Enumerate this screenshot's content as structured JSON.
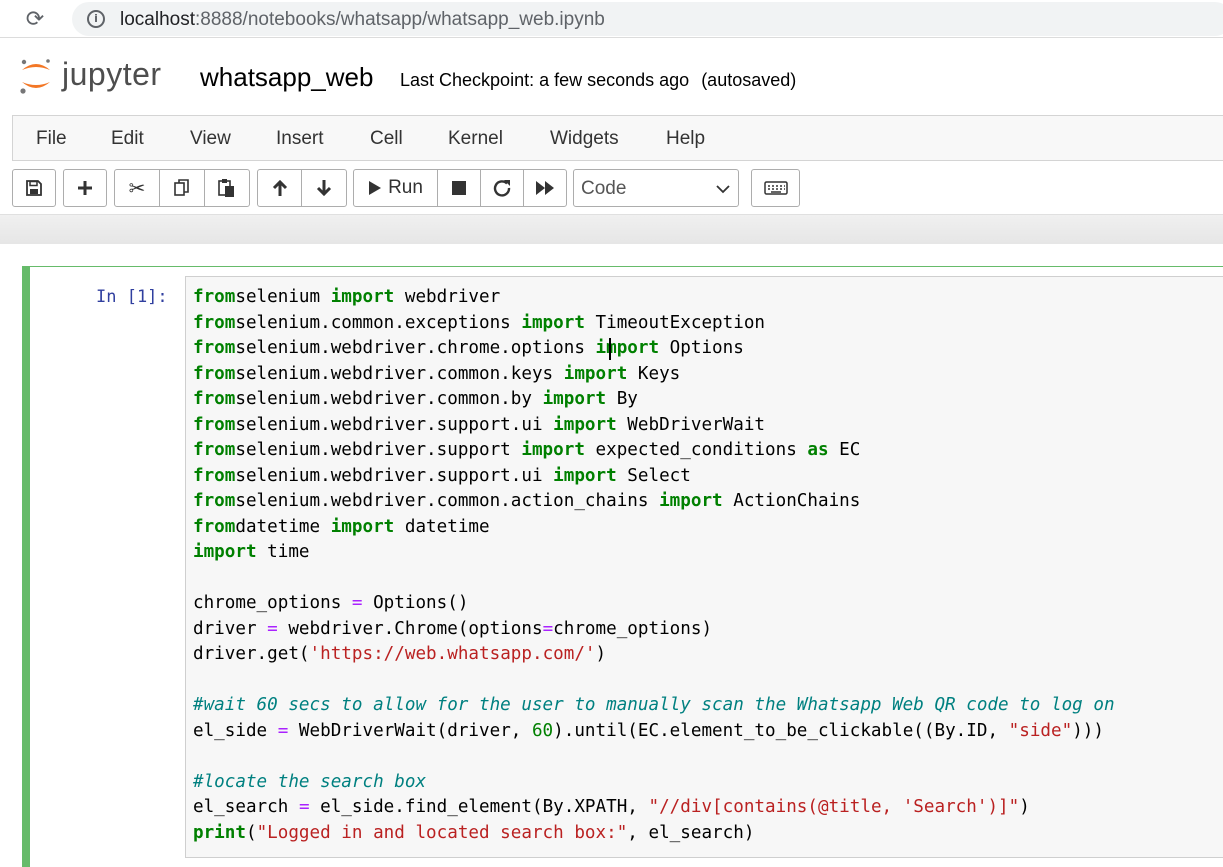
{
  "browser": {
    "url_host": "localhost",
    "url_rest": ":8888/notebooks/whatsapp/whatsapp_web.ipynb"
  },
  "header": {
    "logo_text": "jupyter",
    "notebook_name": "whatsapp_web",
    "checkpoint": "Last Checkpoint: a few seconds ago",
    "autosave": "(autosaved)"
  },
  "menu": [
    "File",
    "Edit",
    "View",
    "Insert",
    "Cell",
    "Kernel",
    "Widgets",
    "Help"
  ],
  "toolbar": {
    "run_label": "Run",
    "cell_type": "Code"
  },
  "cell": {
    "prompt": "In [1]:",
    "lines": [
      [
        [
          "kw",
          "from"
        ],
        [
          "",
          "selenium "
        ],
        [
          "kw",
          "import"
        ],
        [
          "",
          " webdriver"
        ]
      ],
      [
        [
          "kw",
          "from"
        ],
        [
          "",
          "selenium.common.exceptions "
        ],
        [
          "kw",
          "import"
        ],
        [
          "",
          " TimeoutException"
        ]
      ],
      [
        [
          "kw",
          "from"
        ],
        [
          "",
          "selenium.webdriver.chrome.options "
        ],
        [
          "kw",
          "import"
        ],
        [
          "",
          " Options"
        ]
      ],
      [
        [
          "kw",
          "from"
        ],
        [
          "",
          "selenium.webdriver.common.keys "
        ],
        [
          "kw",
          "import"
        ],
        [
          "",
          " Keys"
        ]
      ],
      [
        [
          "kw",
          "from"
        ],
        [
          "",
          "selenium.webdriver.common.by "
        ],
        [
          "kw",
          "import"
        ],
        [
          "",
          " By"
        ]
      ],
      [
        [
          "kw",
          "from"
        ],
        [
          "",
          "selenium.webdriver.support.ui "
        ],
        [
          "kw",
          "import"
        ],
        [
          "",
          " WebDriverWait"
        ]
      ],
      [
        [
          "kw",
          "from"
        ],
        [
          "",
          "selenium.webdriver.support "
        ],
        [
          "kw",
          "import"
        ],
        [
          "",
          " expected_conditions "
        ],
        [
          "kw",
          "as"
        ],
        [
          "",
          " EC"
        ]
      ],
      [
        [
          "kw",
          "from"
        ],
        [
          "",
          "selenium.webdriver.support.ui "
        ],
        [
          "kw",
          "import"
        ],
        [
          "",
          " Select"
        ]
      ],
      [
        [
          "kw",
          "from"
        ],
        [
          "",
          "selenium.webdriver.common.action_chains "
        ],
        [
          "kw",
          "import"
        ],
        [
          "",
          " ActionChains"
        ]
      ],
      [
        [
          "kw",
          "from"
        ],
        [
          "",
          "datetime "
        ],
        [
          "kw",
          "import"
        ],
        [
          "",
          " datetime"
        ]
      ],
      [
        [
          "kw",
          "import"
        ],
        [
          "",
          " time"
        ]
      ],
      [],
      [
        [
          "",
          "chrome_options "
        ],
        [
          "op",
          "="
        ],
        [
          "",
          " Options()"
        ]
      ],
      [
        [
          "",
          "driver "
        ],
        [
          "op",
          "="
        ],
        [
          "",
          " webdriver.Chrome(options"
        ],
        [
          "op",
          "="
        ],
        [
          "",
          "chrome_options)"
        ]
      ],
      [
        [
          "",
          "driver.get("
        ],
        [
          "str",
          "'https://web.whatsapp.com/'"
        ],
        [
          "",
          ")"
        ]
      ],
      [],
      [
        [
          "cm",
          "#wait 60 secs to allow for the user to manually scan the Whatsapp Web QR code to log on"
        ]
      ],
      [
        [
          "",
          "el_side "
        ],
        [
          "op",
          "="
        ],
        [
          "",
          " WebDriverWait(driver, "
        ],
        [
          "num",
          "60"
        ],
        [
          "",
          ").until(EC.element_to_be_clickable((By.ID, "
        ],
        [
          "str",
          "\"side\""
        ],
        [
          "",
          ")))"
        ]
      ],
      [],
      [
        [
          "cm",
          "#locate the search box"
        ]
      ],
      [
        [
          "",
          "el_search "
        ],
        [
          "op",
          "="
        ],
        [
          "",
          " el_side.find_element(By.XPATH, "
        ],
        [
          "str",
          "\"//div[contains(@title, 'Search')]\""
        ],
        [
          "",
          ")"
        ]
      ],
      [
        [
          "kw",
          "print"
        ],
        [
          "",
          "("
        ],
        [
          "str",
          "\"Logged in and located search box:\""
        ],
        [
          "",
          ", el_search)"
        ]
      ]
    ]
  }
}
